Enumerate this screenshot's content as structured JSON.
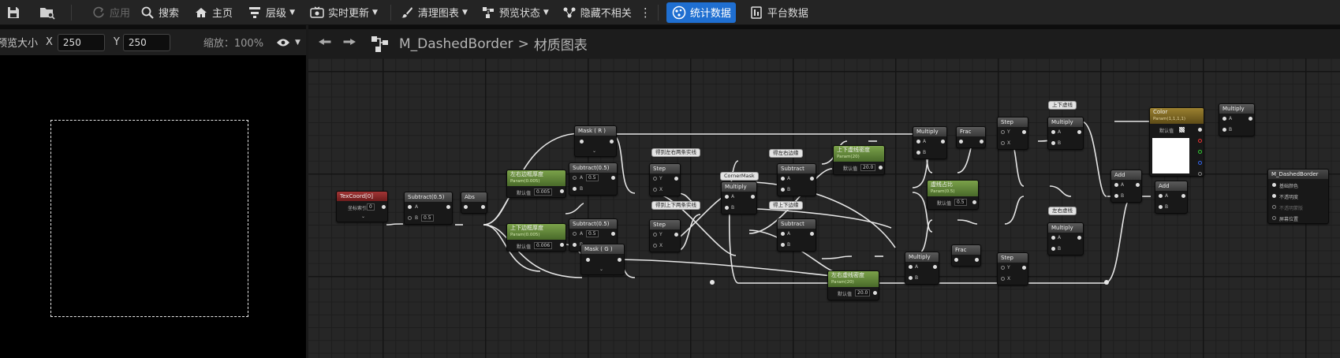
{
  "toolbar": {
    "apply": "应用",
    "search": "搜索",
    "home": "主页",
    "hierarchy": "层级",
    "live_update": "实时更新",
    "clean_graph": "清理图表",
    "preview_state": "预览状态",
    "hide_unrelated": "隐藏不相关",
    "stats": "统计数据",
    "platform_stats": "平台数据"
  },
  "preview": {
    "size_label": "预览大小",
    "x_label": "X",
    "x_value": "250",
    "y_label": "Y",
    "y_value": "250",
    "zoom": "缩放：100%"
  },
  "graph": {
    "breadcrumb_asset": "M_DashedBorder",
    "breadcrumb_sep": ">",
    "breadcrumb_page": "材质图表"
  },
  "nodes": {
    "texcoord": "TexCoord[0]",
    "coord_index": "坐标索引",
    "coord_index_val": "0",
    "subtract1": "Subtract(0.5)",
    "a": "A",
    "b": "B",
    "b_val": "0.5",
    "abs": "Abs",
    "mask_r": "Mask ( R )",
    "mask_g": "Mask ( G )",
    "lr_width": "左右边框厚度",
    "lr_width_sub": "Param(0.005)",
    "default": "默认值",
    "lr_width_val": "0.005",
    "tb_width": "上下边框厚度",
    "tb_width_sub": "Param(0.005)",
    "tb_width_val": "0.006",
    "sub2": "Subtract(0.5)",
    "sub2_val": "0.5",
    "sub3": "Subtract(0.5)",
    "sub3_val": "0.5",
    "step": "Step",
    "y": "Y",
    "x": "X",
    "corner_mask": "CornerMask",
    "multiply": "Multiply",
    "subtract": "Subtract",
    "tb_density": "上下虚线密度",
    "tb_density_sub": "Param(20)",
    "tb_density_val": "20.0",
    "lr_density": "左右虚线密度",
    "lr_density_sub": "Param(20)",
    "lr_density_val": "20.0",
    "dash_ratio": "虚线占比",
    "dash_ratio_sub": "Param(0.5)",
    "dash_ratio_val": "0.5",
    "frac": "Frac",
    "add": "Add",
    "color": "Color",
    "color_sub": "Param(1,1,1,1)",
    "result": "M_DashedBorder",
    "out_base": "基础颜色",
    "out_opacity": "不透明度",
    "out_opmask": "不透明蒙版",
    "out_screen": "屏幕位置"
  },
  "comments": {
    "c1": "得到左右两条实线",
    "c2": "得到上下两条实线",
    "c3": "得左右边缘",
    "c4": "得上下边缘",
    "c5": "上下虚线",
    "c6": "左右虚线"
  },
  "colors": {
    "accent": "#1f6fd1",
    "wire": "#e6e6e6",
    "param_green": "#6b8f3e",
    "texcoord_red": "#8f2a2a",
    "color_gold": "#8a7127"
  }
}
